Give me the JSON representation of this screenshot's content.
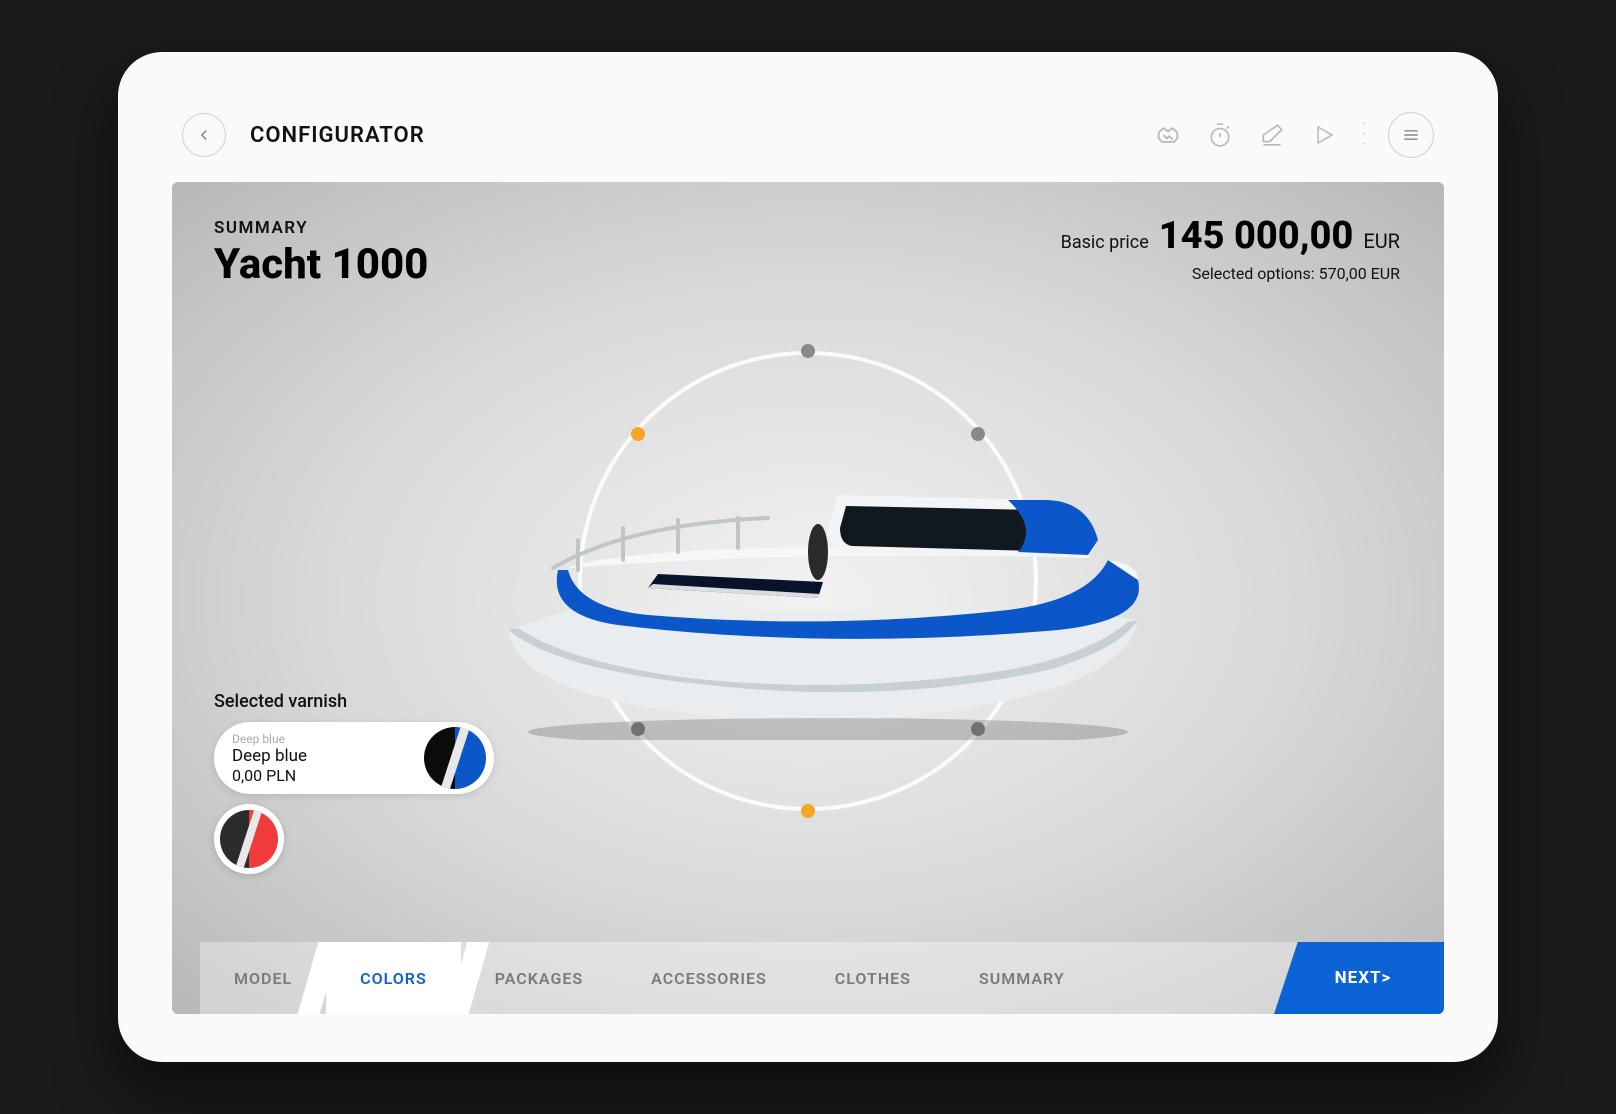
{
  "header": {
    "title": "CONFIGURATOR",
    "icons": [
      "handshake-icon",
      "stopwatch-icon",
      "eraser-icon",
      "play-icon"
    ]
  },
  "summary": {
    "label": "SUMMARY",
    "model_name": "Yacht 1000"
  },
  "pricing": {
    "basic_label": "Basic price",
    "basic_value": "145 000,00",
    "currency": "EUR",
    "options_line": "Selected options: 570,00 EUR"
  },
  "varnish": {
    "label": "Selected varnish",
    "selected": {
      "small_label": "Deep blue",
      "name": "Deep blue",
      "price": "0,00 PLN",
      "color_a": "#0b0b0b",
      "color_b": "#0b56c8",
      "stripe": "#e8e8e8"
    },
    "alt": {
      "color_a": "#2b2b2b",
      "color_b": "#ef3b3b",
      "stripe": "#e8e8e8"
    }
  },
  "tabs": {
    "items": [
      "MODEL",
      "COLORS",
      "PACKAGES",
      "ACCESSORIES",
      "CLOTHES",
      "SUMMARY"
    ],
    "active_index": 1,
    "next_label": "NEXT>"
  },
  "colors": {
    "accent": "#0b63d6",
    "orange": "#f5a623"
  }
}
